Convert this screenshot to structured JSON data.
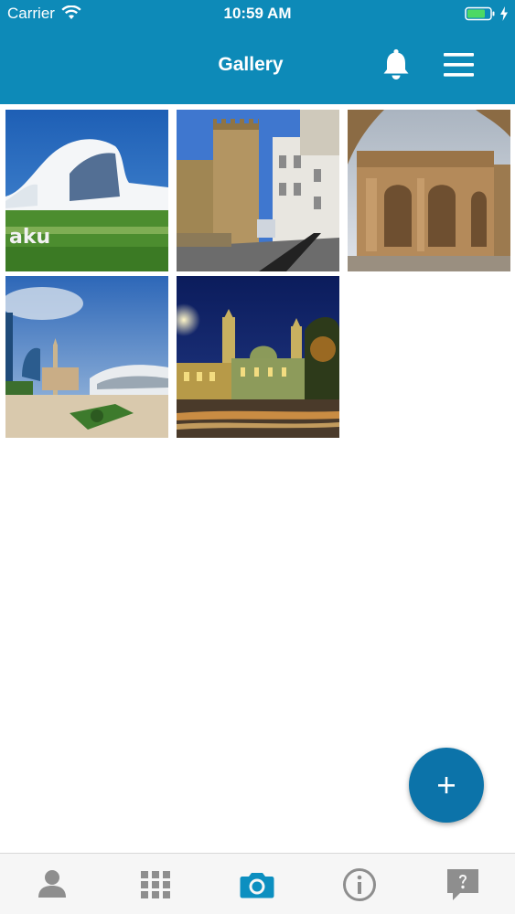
{
  "status_bar": {
    "carrier": "Carrier",
    "time": "10:59 AM",
    "wifi_icon": "wifi-icon",
    "battery_icon": "battery-icon",
    "charging_icon": "charging-bolt-icon"
  },
  "header": {
    "title": "Gallery",
    "background_color": "#0d8ab8",
    "notifications_icon": "bell-icon",
    "menu_icon": "hamburger-menu-icon"
  },
  "gallery": {
    "photos": [
      {
        "name": "photo-heydar-aliyev-center"
      },
      {
        "name": "photo-old-city-tower"
      },
      {
        "name": "photo-stone-mausoleum"
      },
      {
        "name": "photo-mosque-and-modern-building"
      },
      {
        "name": "photo-night-mosque"
      }
    ]
  },
  "fab": {
    "label": "+",
    "color": "#0c73a9"
  },
  "tabbar": {
    "active_color": "#0c8fc0",
    "inactive_color": "#8e8e8e",
    "tabs": [
      {
        "icon": "person-icon",
        "active": false
      },
      {
        "icon": "grid-icon",
        "active": false
      },
      {
        "icon": "camera-icon",
        "active": true
      },
      {
        "icon": "info-icon",
        "active": false
      },
      {
        "icon": "help-chat-icon",
        "active": false
      }
    ]
  }
}
